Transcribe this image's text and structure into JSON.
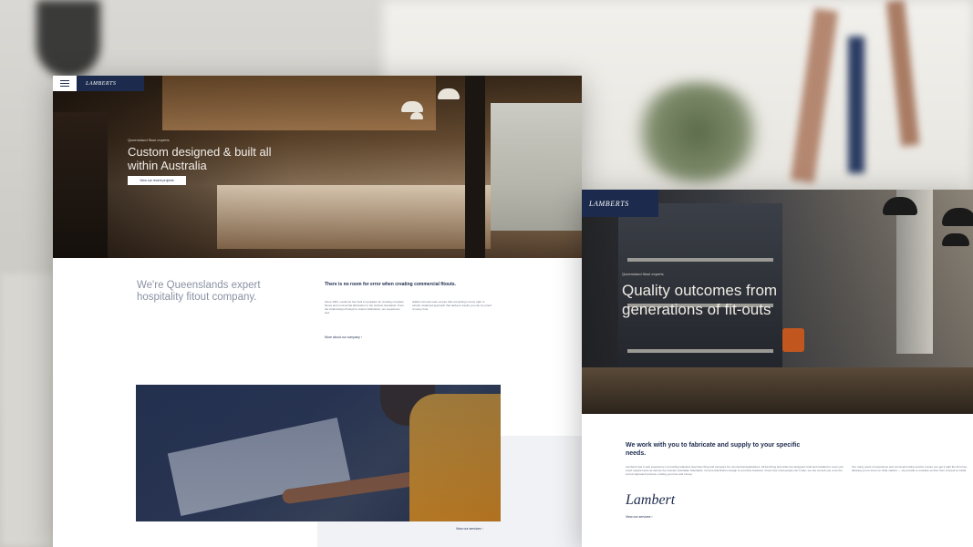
{
  "page1": {
    "logo": "LAMBERTS",
    "hero": {
      "eyebrow": "Queensland fitout experts",
      "title": "Custom designed & built all within Australia",
      "cta": "View our recent projects"
    },
    "intro": {
      "heading": "We're Queenslands expert hospitality fitout company.",
      "subheading": "There is no room for error when creating commercial fitouts.",
      "body_1": "Since 1951, Lamberts has built a reputation for creating complete fitouts and commercial fabrication to the strictest standards. From the initial design through to custom fabrication, our experience and",
      "body_2": "skilled in-house team ensure that everything is done right. A careful, detail-led approach that delivers results you can be proud of every time.",
      "link": "More about our company"
    },
    "services_link": "View our services"
  },
  "page2": {
    "logo": "LAMBERTS",
    "hero": {
      "eyebrow": "Queensland fitout experts",
      "title": "Quality outcomes from generations of fit-outs"
    },
    "heading": "We work with you to fabricate and supply to your specific needs.",
    "body_1": "Lamberts has a vast experience in providing stainless steel benching and canopies for commercial applications. All benching and sinks are designed, built and installed to meet your exact requirements as well as the relevant Australian Standards. Commercial kitchen design is a precise business. Know how most people can't cater, we can consult you to be the correct approach process, costing you time and money.",
    "body_2": "Our many years of experience and uncompromising service ensure you get it right the first time, allowing you to focus on what matters — we provide a complete service from concept to install.",
    "signature": "Lambert",
    "link": "View our services"
  }
}
